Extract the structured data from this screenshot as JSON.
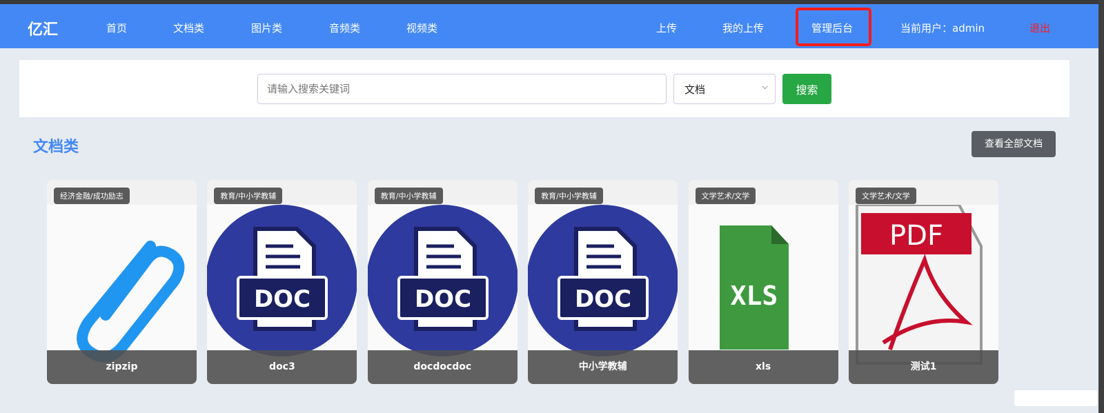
{
  "nav": {
    "logo": "亿汇",
    "items": [
      "首页",
      "文档类",
      "图片类",
      "音频类",
      "视频类"
    ],
    "right": [
      "上传",
      "我的上传",
      "管理后台"
    ],
    "current_user": "当前用户：admin",
    "logout": "退出"
  },
  "search": {
    "placeholder": "请输入搜索关键词",
    "category": "文档",
    "button": "搜索"
  },
  "section": {
    "title": "文档类",
    "view_all": "查看全部文档"
  },
  "cards": [
    {
      "tag": "经济金融/成功励志",
      "name": "zipzip",
      "icon": "paperclip-icon"
    },
    {
      "tag": "教育/中小学教辅",
      "name": "doc3",
      "icon": "doc-icon"
    },
    {
      "tag": "教育/中小学教辅",
      "name": "docdocdoc",
      "icon": "doc-icon"
    },
    {
      "tag": "教育/中小学教辅",
      "name": "中小学教辅",
      "icon": "doc-icon"
    },
    {
      "tag": "文学艺术/文学",
      "name": "xls",
      "icon": "xls-icon"
    },
    {
      "tag": "文学艺术/文学",
      "name": "测试1",
      "icon": "pdf-icon"
    }
  ],
  "icon_labels": {
    "doc": "DOC",
    "xls": "XLS",
    "pdf": "PDF"
  }
}
